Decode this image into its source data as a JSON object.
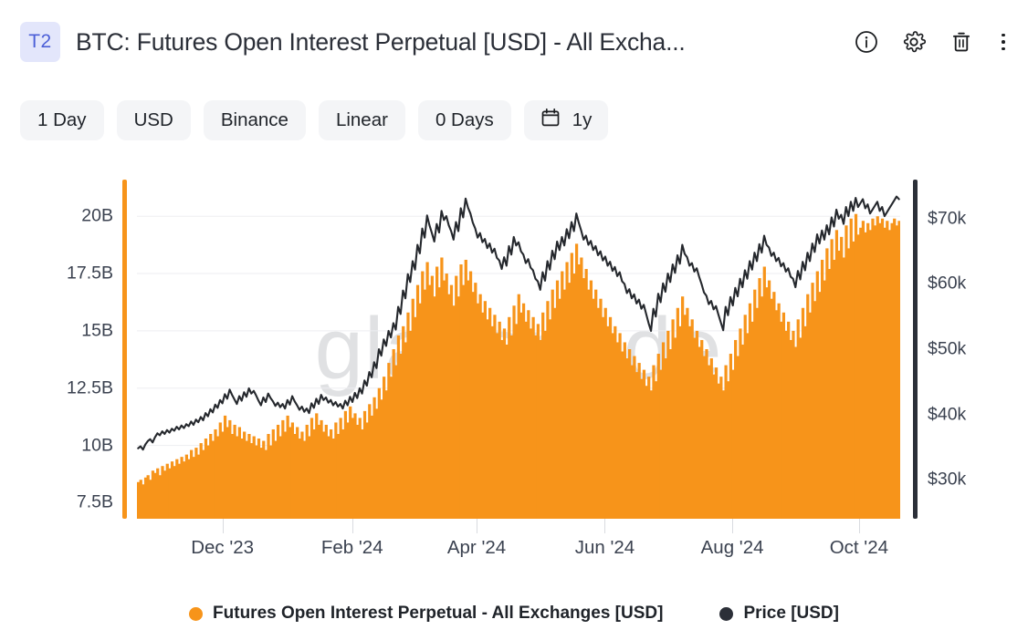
{
  "header": {
    "badge": "T2",
    "title": "BTC: Futures Open Interest Perpetual [USD] - All Excha...",
    "icons": [
      {
        "name": "info-icon",
        "label": "Info"
      },
      {
        "name": "gear-icon",
        "label": "Settings"
      },
      {
        "name": "trash-icon",
        "label": "Delete"
      },
      {
        "name": "kebab-menu-icon",
        "label": "More options"
      }
    ]
  },
  "toolbar": {
    "resolution": "1 Day",
    "currency": "USD",
    "exchange": "Binance",
    "scale": "Linear",
    "smoothing": "0 Days",
    "timeframe": "1y",
    "calendar_icon": "calendar-icon"
  },
  "watermark": "glassnode",
  "colors": {
    "series_orange": "#f7941a",
    "price_black": "#25282d",
    "badge_bg": "#e3e6fb",
    "badge_text": "#4c5fd7",
    "gridline": "#edeef1",
    "axis_right": "#2b2f38"
  },
  "legend": [
    {
      "label": "Futures Open Interest Perpetual - All Exchanges [USD]",
      "color": "#f7941a",
      "name": "legend-item-open-interest"
    },
    {
      "label": "Price [USD]",
      "color": "#2b2f38",
      "name": "legend-item-price"
    }
  ],
  "chart_data": {
    "type": "bar",
    "title": "BTC: Futures Open Interest Perpetual [USD] - All Exchanges",
    "xlabel": "",
    "ylabel": "Futures Open Interest Perpetual [USD]",
    "y2label": "Price [USD]",
    "grid": true,
    "legend_position": "bottom",
    "x_tick_labels": [
      "Dec '23",
      "Feb '24",
      "Apr '24",
      "Jun '24",
      "Aug '24",
      "Oct '24"
    ],
    "x_tick_positions": [
      0.112,
      0.282,
      0.445,
      0.613,
      0.78,
      0.946
    ],
    "y_tick_labels": [
      "20B",
      "17.5B",
      "15B",
      "12.5B",
      "10B",
      "7.5B"
    ],
    "y_tick_values": [
      20,
      17.5,
      15,
      12.5,
      10,
      7.5
    ],
    "ylim": [
      6.8,
      21.6
    ],
    "y2_tick_labels": [
      "$70k",
      "$60k",
      "$50k",
      "$40k",
      "$30k"
    ],
    "y2_tick_values": [
      70000,
      60000,
      50000,
      40000,
      30000
    ],
    "y2lim": [
      24000,
      76000
    ],
    "x_range": [
      "2023-11-01",
      "2024-11-01"
    ],
    "series": [
      {
        "name": "Futures Open Interest Perpetual - All Exchanges [USD]",
        "type": "bar",
        "axis": "left",
        "unit": "USD billions",
        "color": "#f7941a",
        "values": [
          8.4,
          8.5,
          8.3,
          8.6,
          8.7,
          8.5,
          8.9,
          8.8,
          9.0,
          8.7,
          9.1,
          8.9,
          9.2,
          9.0,
          9.3,
          9.1,
          9.4,
          9.2,
          9.5,
          9.3,
          9.6,
          9.4,
          9.8,
          9.5,
          9.9,
          9.6,
          10.1,
          9.8,
          10.3,
          10.0,
          10.5,
          10.2,
          10.7,
          10.4,
          11.0,
          10.6,
          11.3,
          10.8,
          11.1,
          10.5,
          10.9,
          10.4,
          10.8,
          10.3,
          10.6,
          10.2,
          10.5,
          10.1,
          10.4,
          10.0,
          10.3,
          9.9,
          10.2,
          9.8,
          10.5,
          10.0,
          10.7,
          10.2,
          10.9,
          10.4,
          11.1,
          10.6,
          11.3,
          10.8,
          11.0,
          10.5,
          10.8,
          10.3,
          10.6,
          10.2,
          10.9,
          10.4,
          11.2,
          10.7,
          11.4,
          10.9,
          11.1,
          10.6,
          10.9,
          10.4,
          10.7,
          10.3,
          11.0,
          10.5,
          11.2,
          10.7,
          11.5,
          11.0,
          11.7,
          11.2,
          11.4,
          10.9,
          11.2,
          10.7,
          11.5,
          11.0,
          11.8,
          11.3,
          12.1,
          11.6,
          12.5,
          12.0,
          13.0,
          12.4,
          13.6,
          13.0,
          14.2,
          13.5,
          14.8,
          14.0,
          15.2,
          14.5,
          15.8,
          15.0,
          16.4,
          15.6,
          17.0,
          16.2,
          17.6,
          16.8,
          18.0,
          17.0,
          17.4,
          16.5,
          17.8,
          16.9,
          18.2,
          17.2,
          17.5,
          16.6,
          17.0,
          16.1,
          17.4,
          16.5,
          17.9,
          17.0,
          18.1,
          17.2,
          17.6,
          16.7,
          17.1,
          16.2,
          16.6,
          15.8,
          16.3,
          15.5,
          16.0,
          15.2,
          15.7,
          14.9,
          15.4,
          14.6,
          15.1,
          14.4,
          15.6,
          14.8,
          16.1,
          15.3,
          16.6,
          15.8,
          16.2,
          15.4,
          15.9,
          15.1,
          15.6,
          14.8,
          15.3,
          14.6,
          15.8,
          15.0,
          16.3,
          15.5,
          16.8,
          16.0,
          17.2,
          16.4,
          17.6,
          16.8,
          18.0,
          17.1,
          18.4,
          17.5,
          18.8,
          17.9,
          18.2,
          17.3,
          17.7,
          16.8,
          17.2,
          16.4,
          16.8,
          16.0,
          16.4,
          15.6,
          16.0,
          15.2,
          15.6,
          14.9,
          15.2,
          14.5,
          14.9,
          14.1,
          14.5,
          13.8,
          14.2,
          13.5,
          13.9,
          13.2,
          13.6,
          12.9,
          13.3,
          12.6,
          13.0,
          12.4,
          13.5,
          12.8,
          14.0,
          13.3,
          14.5,
          13.8,
          15.0,
          14.2,
          15.5,
          14.7,
          16.0,
          15.2,
          16.5,
          15.7,
          16.0,
          15.2,
          15.5,
          14.7,
          15.0,
          14.3,
          14.6,
          13.9,
          14.2,
          13.5,
          13.8,
          13.1,
          13.4,
          12.7,
          13.0,
          12.4,
          13.5,
          12.8,
          14.0,
          13.3,
          14.6,
          13.9,
          15.1,
          14.4,
          15.7,
          14.9,
          16.2,
          15.4,
          16.8,
          16.0,
          17.3,
          16.5,
          17.8,
          16.9,
          17.2,
          16.4,
          16.7,
          15.9,
          16.2,
          15.4,
          15.8,
          15.0,
          15.4,
          14.6,
          15.0,
          14.3,
          15.5,
          14.7,
          16.0,
          15.2,
          16.6,
          15.8,
          17.1,
          16.3,
          17.6,
          16.7,
          18.1,
          17.2,
          18.6,
          17.7,
          19.0,
          18.1,
          19.4,
          18.5,
          19.1,
          18.2,
          19.6,
          18.6,
          19.9,
          18.9,
          20.1,
          19.2,
          19.5,
          19.8,
          19.3,
          19.7,
          19.4,
          19.9,
          19.6,
          20.0,
          19.7,
          19.9,
          19.5,
          19.8,
          19.4,
          19.7,
          19.9,
          19.6,
          19.8
        ]
      },
      {
        "name": "Price [USD]",
        "type": "line",
        "axis": "right",
        "unit": "USD",
        "color": "#25282d",
        "values": [
          34800,
          35100,
          34600,
          35400,
          35900,
          36200,
          35700,
          36500,
          37100,
          36800,
          37400,
          37000,
          37600,
          37200,
          37800,
          37500,
          38100,
          37700,
          38300,
          37900,
          38500,
          38200,
          38900,
          38400,
          39200,
          38800,
          39600,
          39100,
          40200,
          39700,
          40800,
          40300,
          41500,
          41000,
          42200,
          41700,
          43100,
          42400,
          43800,
          43000,
          42300,
          41600,
          42800,
          42100,
          43400,
          42700,
          44000,
          43200,
          43600,
          42900,
          42100,
          41400,
          42600,
          41900,
          43200,
          42500,
          42000,
          41300,
          41800,
          41100,
          41600,
          40900,
          42200,
          41500,
          42800,
          42000,
          41400,
          40700,
          41200,
          40400,
          40900,
          40200,
          41700,
          41000,
          42400,
          41600,
          43000,
          42200,
          42600,
          41800,
          42200,
          41400,
          41900,
          41200,
          41600,
          40900,
          42100,
          41400,
          42700,
          41900,
          43300,
          42500,
          44000,
          43200,
          45200,
          44400,
          46500,
          45700,
          48000,
          47100,
          50000,
          49000,
          51500,
          50500,
          52800,
          51800,
          54000,
          53000,
          56500,
          55400,
          59000,
          57800,
          61500,
          60300,
          63500,
          62200,
          66000,
          64700,
          68500,
          67100,
          70500,
          69000,
          67800,
          66500,
          69200,
          67900,
          71200,
          69800,
          70400,
          69000,
          68100,
          66800,
          69500,
          68100,
          71600,
          70200,
          73100,
          71700,
          70800,
          69400,
          68500,
          67100,
          67800,
          66400,
          66900,
          65500,
          66200,
          64800,
          65400,
          64000,
          63600,
          62300,
          64100,
          62800,
          65800,
          64500,
          67200,
          65900,
          66400,
          65000,
          64500,
          63200,
          63800,
          62500,
          62100,
          60800,
          60400,
          59100,
          61800,
          60500,
          63500,
          62200,
          65100,
          63800,
          66500,
          65200,
          67200,
          65900,
          68400,
          67000,
          69500,
          68100,
          70800,
          69400,
          68200,
          66800,
          67400,
          66000,
          66600,
          65200,
          65800,
          64400,
          65000,
          63600,
          64200,
          62800,
          63400,
          62000,
          62600,
          61200,
          61800,
          60400,
          60000,
          58600,
          59200,
          57800,
          58400,
          57000,
          57600,
          56200,
          56800,
          55400,
          54000,
          52800,
          56200,
          55000,
          58500,
          57200,
          60100,
          58800,
          61600,
          60300,
          63000,
          61700,
          64400,
          63100,
          66000,
          64600,
          64100,
          62800,
          63200,
          61900,
          62400,
          61100,
          60000,
          58700,
          58200,
          56900,
          57400,
          56100,
          56600,
          55300,
          54100,
          52900,
          56500,
          55200,
          58000,
          56700,
          59400,
          58100,
          60800,
          59500,
          62100,
          60800,
          63500,
          62200,
          64800,
          63500,
          66100,
          64800,
          67400,
          66000,
          65600,
          64300,
          64800,
          63500,
          64000,
          62700,
          63200,
          61900,
          62400,
          61100,
          60800,
          59500,
          62000,
          60700,
          63400,
          62100,
          64800,
          63500,
          66200,
          64900,
          67600,
          66200,
          68200,
          66800,
          69000,
          67600,
          70200,
          68800,
          71400,
          70000,
          70600,
          69200,
          71800,
          70400,
          72600,
          71200,
          73200,
          71800,
          72400,
          73000,
          71600,
          72200,
          70800,
          71400,
          72000,
          72600,
          71200,
          71800,
          70400,
          71000,
          71600,
          72200,
          72800,
          73400,
          73000
        ]
      }
    ]
  }
}
